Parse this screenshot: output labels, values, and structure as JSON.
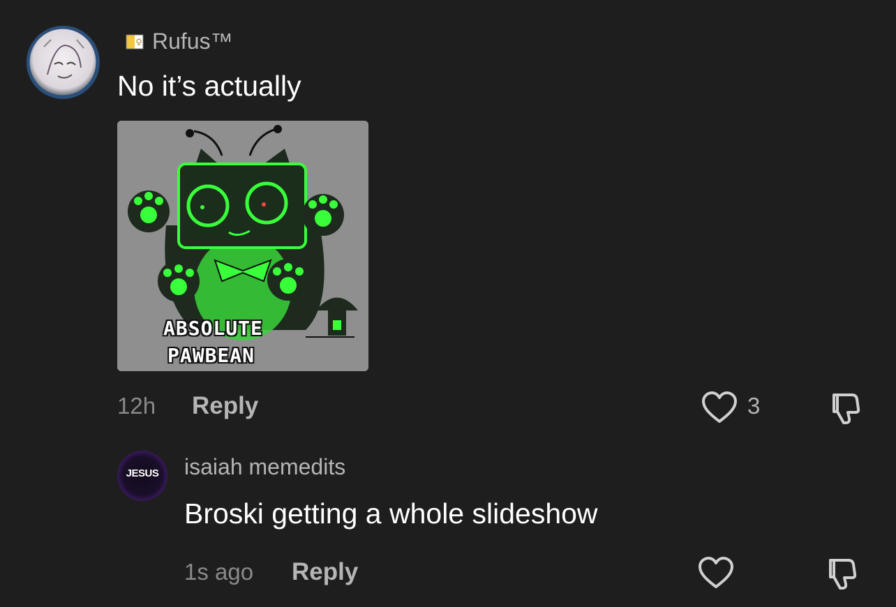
{
  "comments": [
    {
      "username": "Rufus™",
      "text": "No it’s actually",
      "time": "12h",
      "reply_label": "Reply",
      "likes": "3",
      "attachment": {
        "caption_line1": "ABSOLUTE",
        "caption_line2": "PAWBEAN",
        "accent_color": "#39ff3a"
      }
    },
    {
      "username": "isaiah memedits",
      "avatar_text": "JESUS",
      "text": "Broski getting a whole slideshow",
      "time": "1s ago",
      "reply_label": "Reply"
    }
  ],
  "icons": {
    "like": "heart-outline-icon",
    "dislike": "thumbs-down-icon",
    "flag": "vatican-flag-icon"
  },
  "colors": {
    "background": "#1e1e1e",
    "username": "#b5b5b5",
    "text": "#ffffff",
    "meta": "#8a8a8a"
  }
}
